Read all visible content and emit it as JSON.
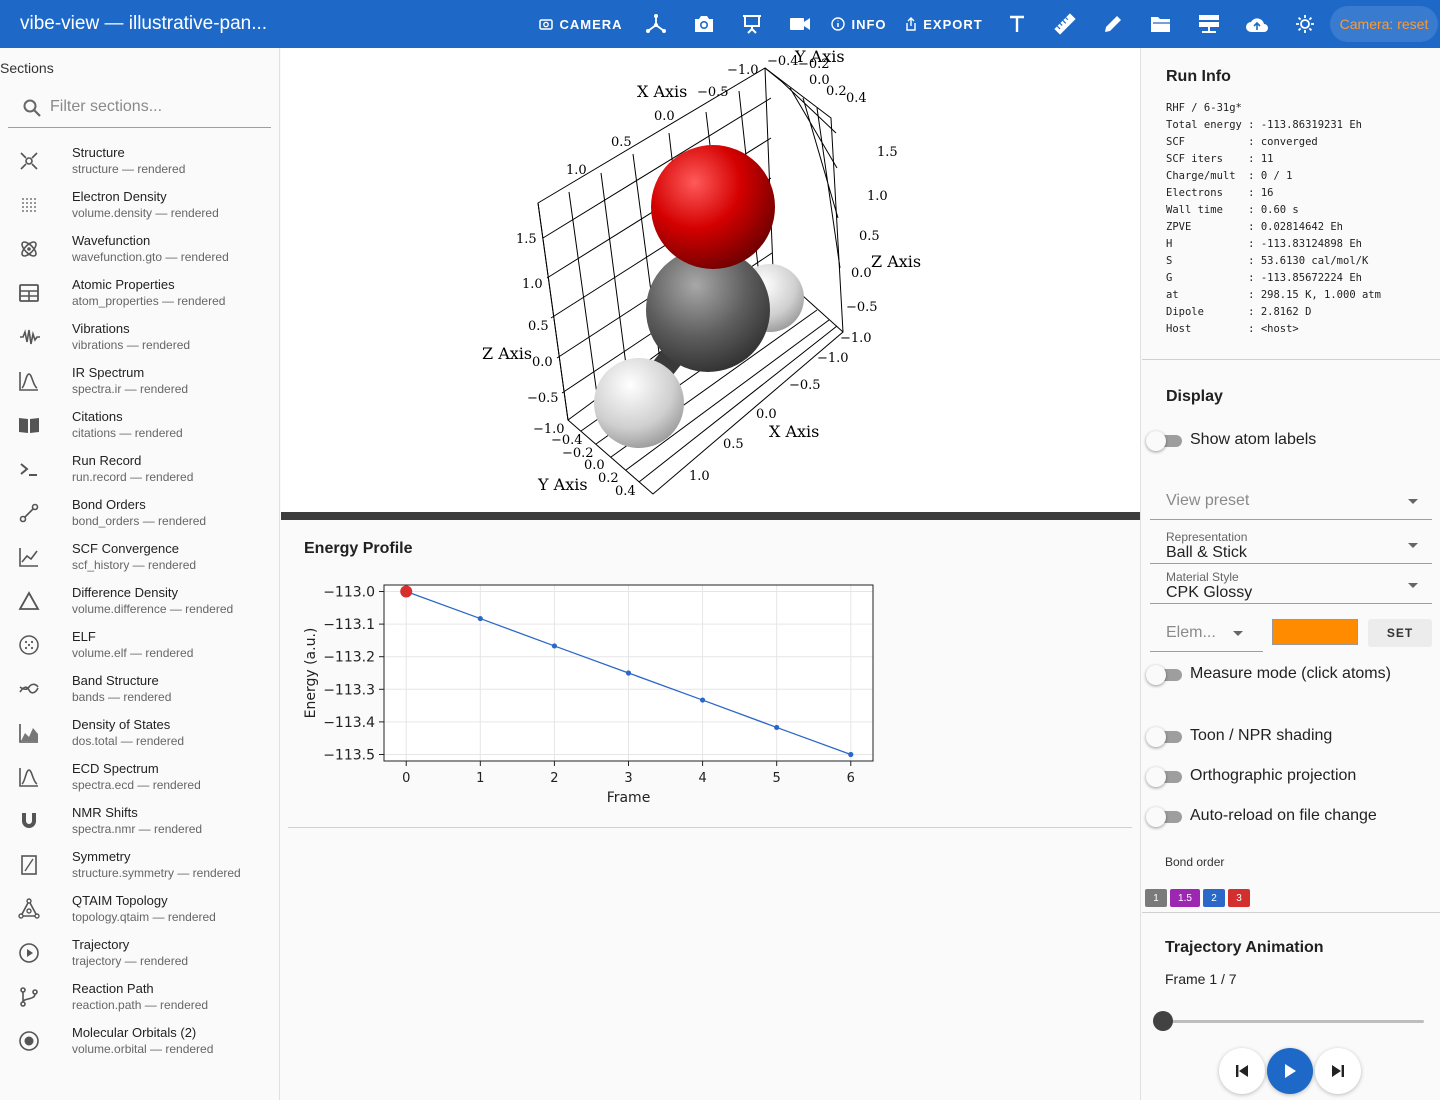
{
  "app": {
    "title": "vibe-view — illustrative-pan..."
  },
  "toolbar": {
    "camera_label": "CAMERA",
    "info_label": "INFO",
    "export_label": "EXPORT",
    "camera_reset_label": "Camera: reset",
    "icons": [
      "axes-icon",
      "screenshot-icon",
      "presentation-icon",
      "video-icon",
      "text-icon",
      "ruler-icon",
      "pencil-icon",
      "folder-icon",
      "server-icon",
      "upload-icon",
      "brightness-icon"
    ]
  },
  "sidebar": {
    "title": "Sections",
    "filter_placeholder": "Filter sections...",
    "items": [
      {
        "label": "Structure",
        "sub": "structure — rendered",
        "icon": "atom-structure-icon"
      },
      {
        "label": "Electron Density",
        "sub": "volume.density — rendered",
        "icon": "grid-dots-icon"
      },
      {
        "label": "Wavefunction",
        "sub": "wavefunction.gto — rendered",
        "icon": "atom-orbit-icon"
      },
      {
        "label": "Atomic Properties",
        "sub": "atom_properties — rendered",
        "icon": "table-icon"
      },
      {
        "label": "Vibrations",
        "sub": "vibrations — rendered",
        "icon": "waveform-icon"
      },
      {
        "label": "IR Spectrum",
        "sub": "spectra.ir — rendered",
        "icon": "spectrum-icon"
      },
      {
        "label": "Citations",
        "sub": "citations — rendered",
        "icon": "book-icon"
      },
      {
        "label": "Run Record",
        "sub": "run.record — rendered",
        "icon": "terminal-icon"
      },
      {
        "label": "Bond Orders",
        "sub": "bond_orders — rendered",
        "icon": "bond-icon"
      },
      {
        "label": "SCF Convergence",
        "sub": "scf_history — rendered",
        "icon": "line-chart-icon"
      },
      {
        "label": "Difference Density",
        "sub": "volume.difference — rendered",
        "icon": "triangle-icon"
      },
      {
        "label": "ELF",
        "sub": "volume.elf — rendered",
        "icon": "dotted-circle-icon"
      },
      {
        "label": "Band Structure",
        "sub": "bands — rendered",
        "icon": "bands-icon"
      },
      {
        "label": "Density of States",
        "sub": "dos.total — rendered",
        "icon": "area-chart-icon"
      },
      {
        "label": "ECD Spectrum",
        "sub": "spectra.ecd — rendered",
        "icon": "spectrum-icon"
      },
      {
        "label": "NMR Shifts",
        "sub": "spectra.nmr — rendered",
        "icon": "magnet-icon"
      },
      {
        "label": "Symmetry",
        "sub": "structure.symmetry — rendered",
        "icon": "symmetry-icon"
      },
      {
        "label": "QTAIM Topology",
        "sub": "topology.qtaim — rendered",
        "icon": "topology-icon"
      },
      {
        "label": "Trajectory",
        "sub": "trajectory — rendered",
        "icon": "play-circle-icon"
      },
      {
        "label": "Reaction Path",
        "sub": "reaction.path — rendered",
        "icon": "branch-icon"
      },
      {
        "label": "Molecular Orbitals (2)",
        "sub": "volume.orbital — rendered",
        "icon": "orbital-icon"
      }
    ]
  },
  "viewer3d": {
    "axis_labels": {
      "x": "X Axis",
      "y": "Y Axis",
      "z": "Z Axis"
    },
    "atoms": [
      {
        "element": "O",
        "color": "#d40000"
      },
      {
        "element": "C",
        "color": "#555555"
      },
      {
        "element": "H",
        "color": "#d8d8d8"
      },
      {
        "element": "H",
        "color": "#d8d8d8"
      }
    ]
  },
  "energy_profile": {
    "title": "Energy Profile"
  },
  "chart_data": {
    "type": "line",
    "title": "Energy Profile",
    "xlabel": "Frame",
    "ylabel": "Energy (a.u.)",
    "x": [
      0,
      1,
      2,
      3,
      4,
      5,
      6
    ],
    "series": [
      {
        "values": [
          -113.0,
          -113.083,
          -113.167,
          -113.25,
          -113.333,
          -113.417,
          -113.5
        ]
      }
    ],
    "xticks": [
      "0",
      "1",
      "2",
      "3",
      "4",
      "5",
      "6"
    ],
    "yticks": [
      "−113.0",
      "−113.1",
      "−113.2",
      "−113.3",
      "−113.4",
      "−113.5"
    ],
    "ylim": [
      -113.52,
      -112.98
    ],
    "xlim": [
      -0.3,
      6.3
    ],
    "highlight_index": 0,
    "line_color": "#2c68c8",
    "highlight_color": "#d62f2f",
    "grid": true
  },
  "run_info": {
    "title": "Run Info",
    "text": "RHF / 6-31g*\nTotal energy : -113.86319231 Eh\nSCF          : converged\nSCF iters    : 11\nCharge/mult  : 0 / 1\nElectrons    : 16\nWall time    : 0.60 s\nZPVE         : 0.02814642 Eh\nH            : -113.83124898 Eh\nS            : 53.6130 cal/mol/K\nG            : -113.85672224 Eh\nat           : 298.15 K, 1.000 atm\nDipole       : 2.8162 D\nHost         : <host>"
  },
  "display": {
    "title": "Display",
    "show_atom_labels": "Show atom labels",
    "view_preset_placeholder": "View preset",
    "representation_caption": "Representation",
    "representation_value": "Ball & Stick",
    "material_caption": "Material Style",
    "material_value": "CPK Glossy",
    "element_placeholder": "Elem...",
    "element_color": "#ff8c00",
    "set_label": "SET",
    "measure_mode": "Measure mode (click atoms)",
    "toon": "Toon / NPR shading",
    "ortho": "Orthographic projection",
    "autoreload": "Auto-reload on file change",
    "bond_order_label": "Bond order",
    "bond_orders": [
      {
        "label": "1",
        "color": "#7a7a7a"
      },
      {
        "label": "1.5",
        "color": "#9c27b0"
      },
      {
        "label": "2",
        "color": "#2c68c8"
      },
      {
        "label": "3",
        "color": "#d32f2f"
      }
    ]
  },
  "trajectory": {
    "title": "Trajectory Animation",
    "frame_text": "Frame 1 / 7",
    "slider_fraction": 0.0
  }
}
